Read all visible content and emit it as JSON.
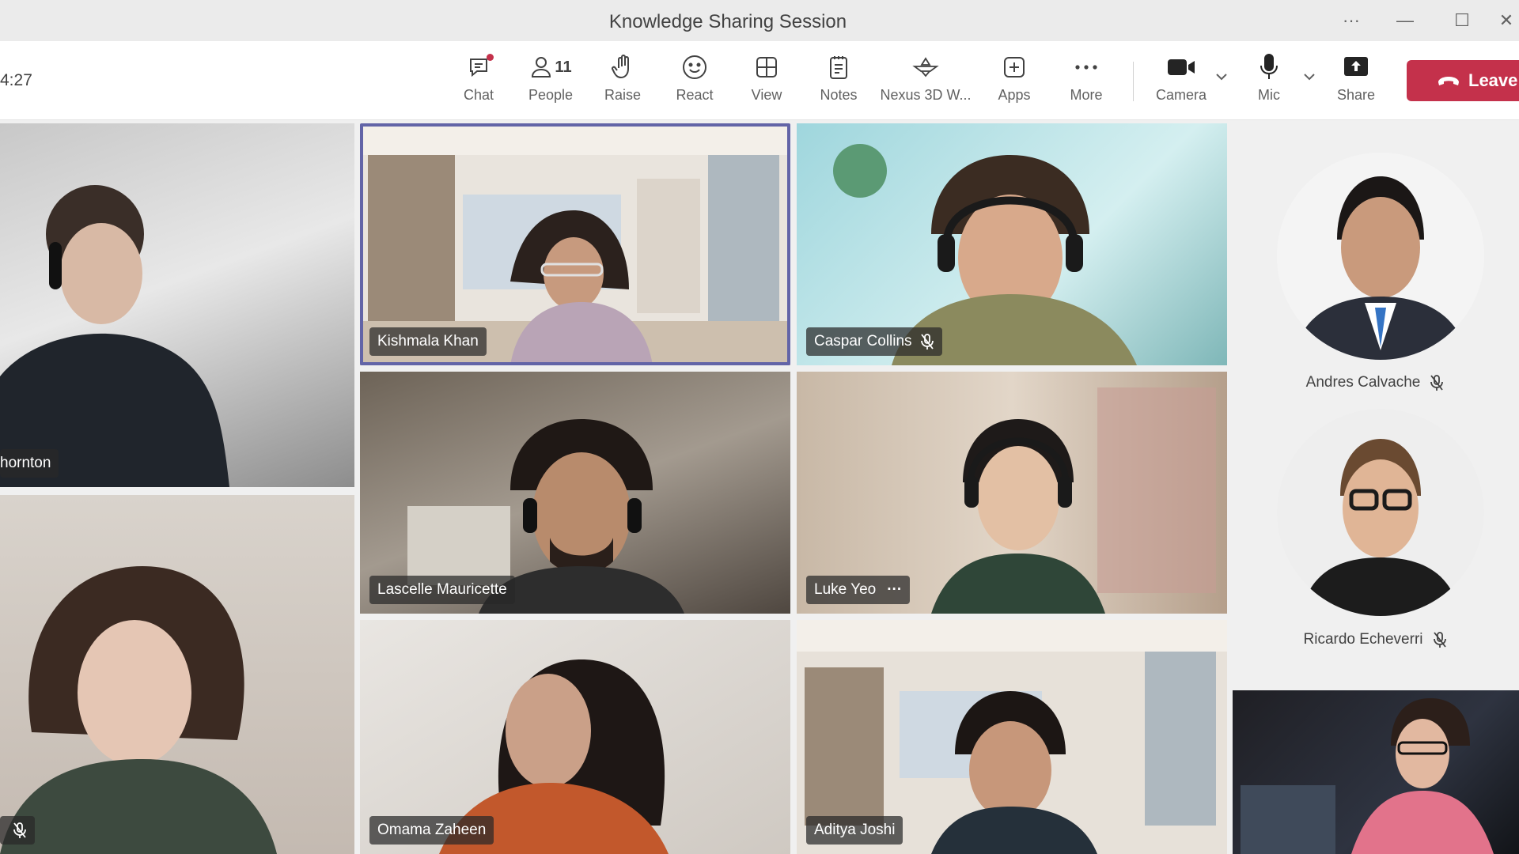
{
  "window": {
    "title": "Knowledge Sharing Session",
    "more_glyph": "···",
    "minimize_glyph": "—",
    "maximize_glyph": "☐",
    "close_glyph": "✕"
  },
  "toolbar": {
    "timer": "4:27",
    "chat_label": "Chat",
    "people_label": "People",
    "people_count": "11",
    "raise_label": "Raise",
    "react_label": "React",
    "view_label": "View",
    "notes_label": "Notes",
    "nexus_label": "Nexus 3D W...",
    "apps_label": "Apps",
    "more_label": "More",
    "camera_label": "Camera",
    "mic_label": "Mic",
    "share_label": "Share",
    "leave_label": "Leave"
  },
  "participants": {
    "thornton": "hornton",
    "kishmala": "Kishmala Khan",
    "caspar": "Caspar Collins",
    "lascelle": "Lascelle Mauricette",
    "luke": "Luke Yeo",
    "luke_more": "···",
    "omama": "Omama Zaheen",
    "aditya": "Aditya Joshi",
    "andres": "Andres Calvache",
    "ricardo": "Ricardo Echeverri"
  },
  "colors": {
    "accent": "#6264a7",
    "leave": "#c4314b",
    "toolbar_bg": "#ffffff",
    "titlebar_bg": "#ebebeb"
  }
}
